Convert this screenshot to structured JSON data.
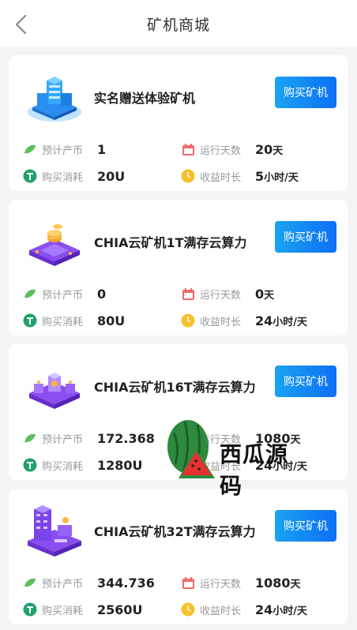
{
  "header": {
    "title": "矿机商城",
    "back_icon": "chevron-left-icon"
  },
  "labels": {
    "estimated_output": "预计产币",
    "purchase_cost": "购买消耗",
    "run_days": "运行天数",
    "income_duration": "收益时长",
    "buy_button": "购买矿机"
  },
  "cards": [
    {
      "name": "实名赠送体验矿机",
      "output": "1",
      "cost": "20U",
      "days": "20",
      "days_unit": "天",
      "duration": "5",
      "duration_unit": "小时/天",
      "image": "server-stack-icon"
    },
    {
      "name": "CHIA云矿机1T满存云算力",
      "output": "0",
      "cost": "80U",
      "days": "0",
      "days_unit": "天",
      "duration": "24",
      "duration_unit": "小时/天",
      "image": "coin-platform-icon"
    },
    {
      "name": "CHIA云矿机16T满存云算力",
      "output": "172.368",
      "cost": "1280U",
      "days": "1080",
      "days_unit": "天",
      "duration": "24",
      "duration_unit": "小时/天",
      "image": "machine-platform-icon"
    },
    {
      "name": "CHIA云矿机32T满存云算力",
      "output": "344.736",
      "cost": "2560U",
      "days": "1080",
      "days_unit": "天",
      "duration": "24",
      "duration_unit": "小时/天",
      "image": "building-platform-icon"
    }
  ],
  "watermark": {
    "text": "西瓜源码",
    "icon": "watermelon-logo"
  },
  "colors": {
    "button_start": "#1aa3f0",
    "button_end": "#0d6ff5",
    "leaf": "#5cbf5c",
    "coin": "#22a06b",
    "calendar": "#f06a6a",
    "clock": "#f5c02a"
  }
}
